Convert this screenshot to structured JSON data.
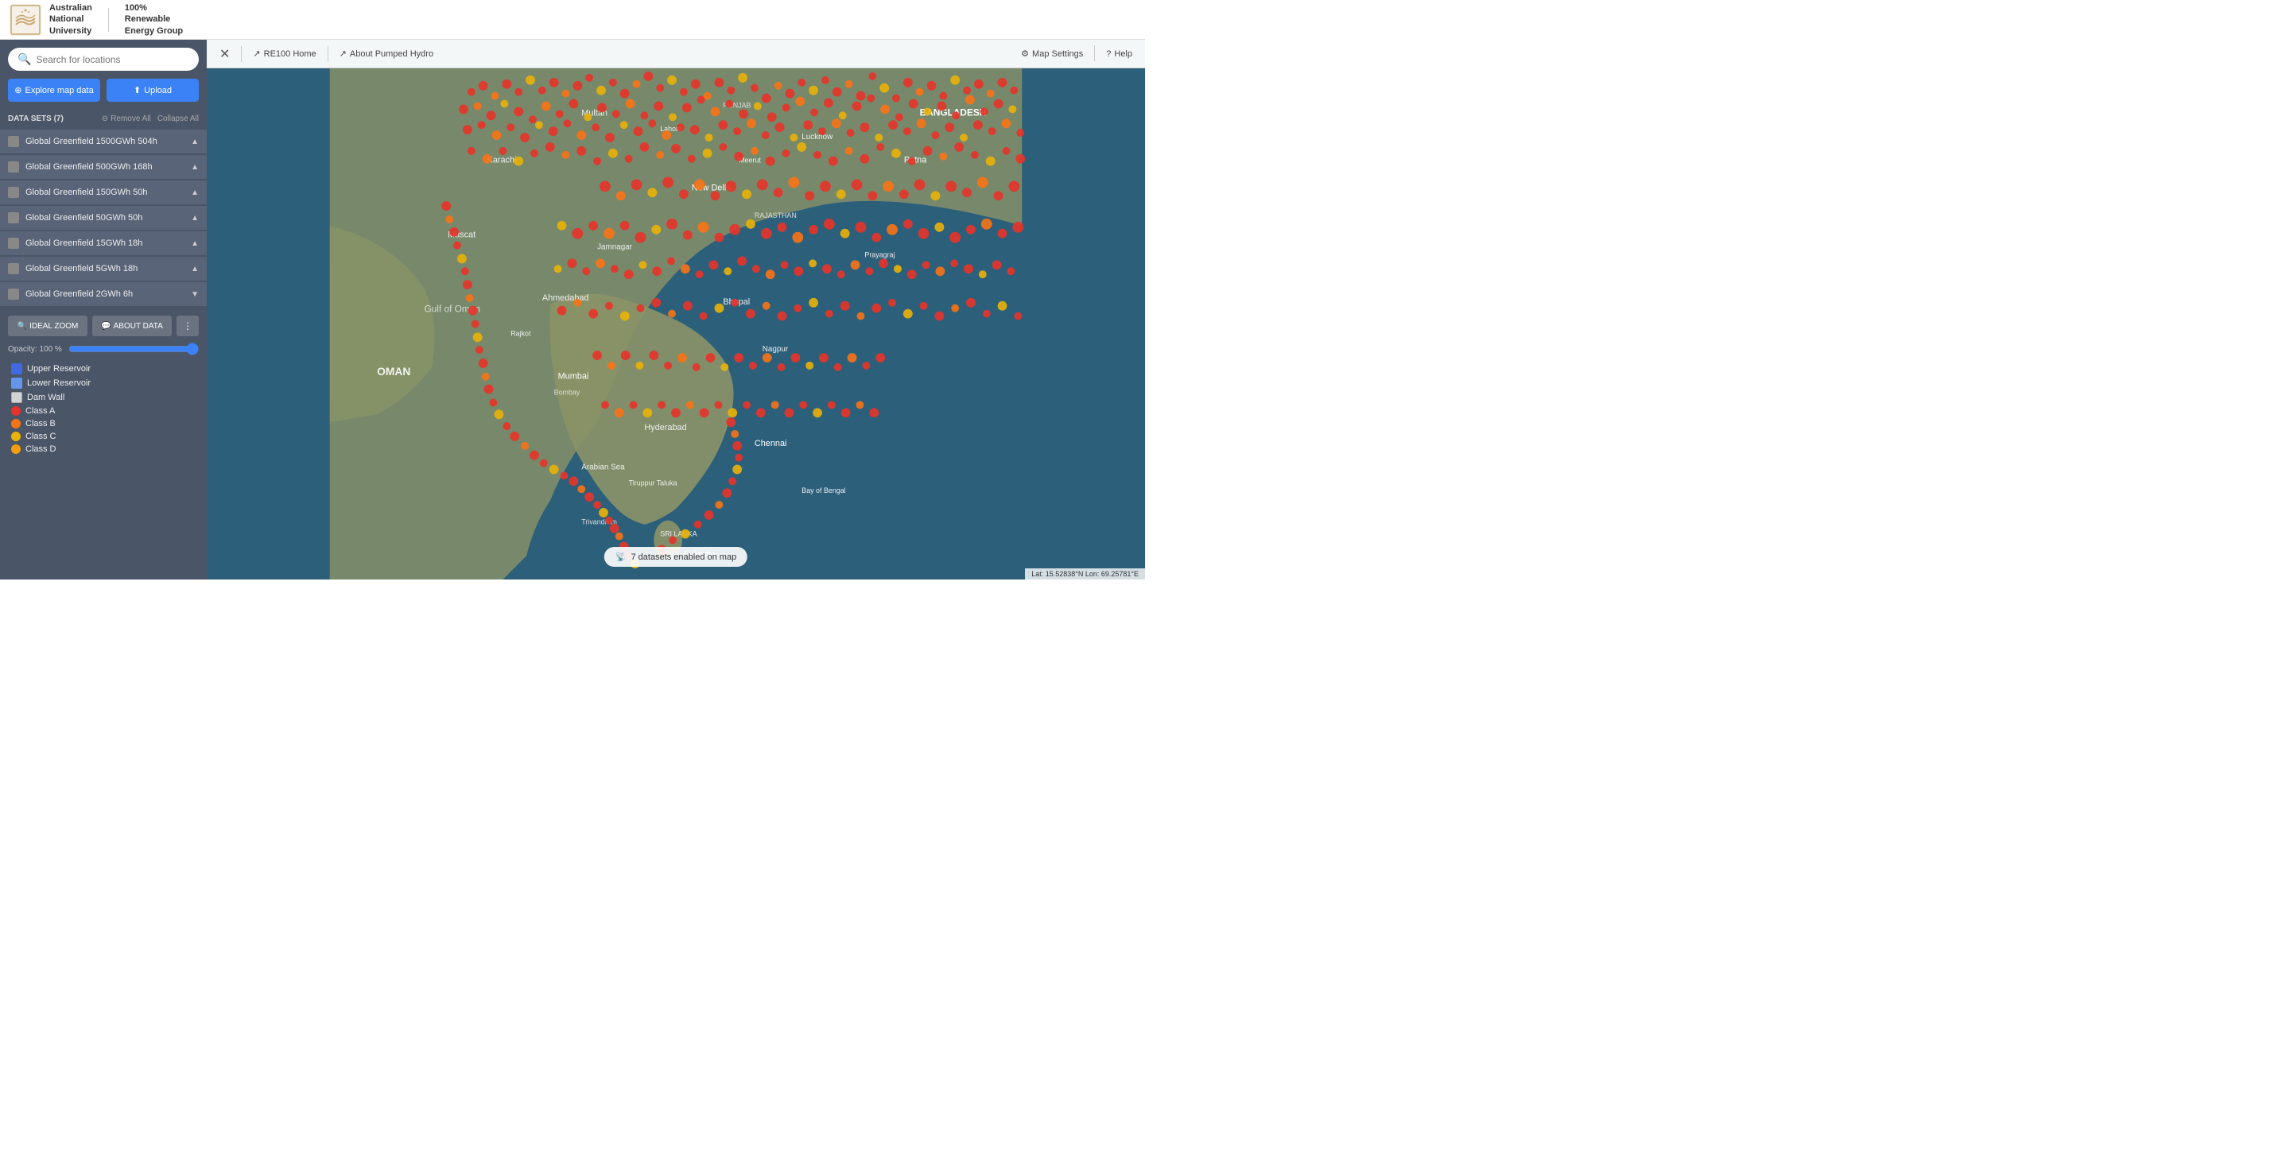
{
  "header": {
    "uni_name": "Australian\nNational\nUniversity",
    "group_name": "100%\nRenewable\nEnergy Group"
  },
  "sidebar": {
    "search_placeholder": "Search for locations",
    "explore_label": "Explore map data",
    "upload_label": "Upload",
    "datasets_count_label": "DATA SETS (7)",
    "remove_all_label": "Remove All",
    "collapse_all_label": "Collapse All",
    "datasets": [
      {
        "id": 1,
        "label": "Global Greenfield 1500GWh 504h",
        "expanded": true
      },
      {
        "id": 2,
        "label": "Global Greenfield 500GWh 168h",
        "expanded": true
      },
      {
        "id": 3,
        "label": "Global Greenfield 150GWh 50h",
        "expanded": true
      },
      {
        "id": 4,
        "label": "Global Greenfield 50GWh 50h",
        "expanded": true
      },
      {
        "id": 5,
        "label": "Global Greenfield 15GWh 18h",
        "expanded": true
      },
      {
        "id": 6,
        "label": "Global Greenfield 5GWh 18h",
        "expanded": true
      },
      {
        "id": 7,
        "label": "Global Greenfield 2GWh 6h",
        "expanded": false
      }
    ],
    "controls": {
      "ideal_zoom_label": "IDEAL ZOOM",
      "about_data_label": "ABOUT DATA",
      "more_label": "⋮",
      "opacity_label": "Opacity: 100 %",
      "opacity_value": 100
    },
    "legend": [
      {
        "type": "box",
        "color": "#4169e1",
        "label": "Upper Reservoir"
      },
      {
        "type": "box",
        "color": "#6495ed",
        "label": "Lower Reservoir"
      },
      {
        "type": "box",
        "color": "#d3d3d3",
        "label": "Dam Wall"
      },
      {
        "type": "circle",
        "color": "#e8332a",
        "label": "Class A"
      },
      {
        "type": "circle",
        "color": "#f97316",
        "label": "Class B"
      },
      {
        "type": "circle",
        "color": "#eab308",
        "label": "Class C"
      },
      {
        "type": "circle",
        "color": "#f59e0b",
        "label": "Class D"
      }
    ]
  },
  "map": {
    "close_label": "✕",
    "re100_home_label": "RE100 Home",
    "about_pumped_hydro_label": "About Pumped Hydro",
    "map_settings_label": "Map Settings",
    "help_label": "Help",
    "dataset_badge_label": "7 datasets enabled on map",
    "coords_label": "Lat: 15.52838°N  Lon: 69.25781°E"
  }
}
